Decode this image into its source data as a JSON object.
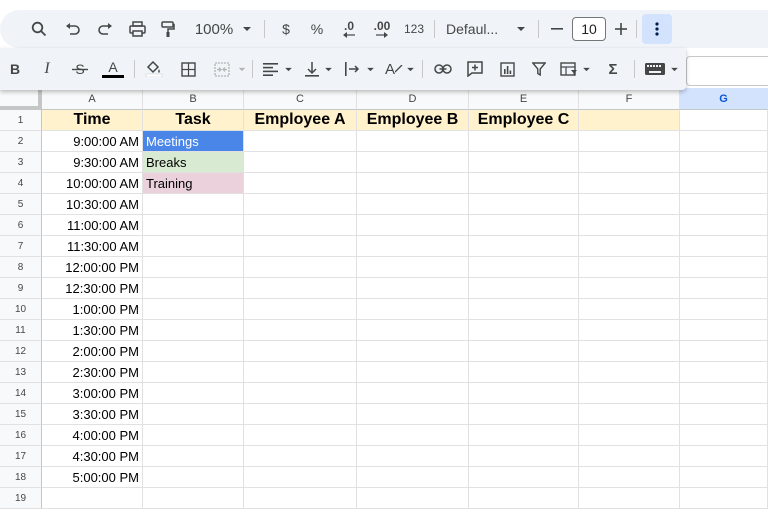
{
  "toolbar": {
    "zoom": "100%",
    "currency": "$",
    "percent": "%",
    "decrease_decimal": ".0",
    "increase_decimal": ".00",
    "number_format": "123",
    "font": "Defaul...",
    "font_size": "10",
    "bold": "B",
    "italic": "I",
    "text_color_label": "A",
    "text_rotation_label": "A",
    "sum": "Σ"
  },
  "colors": {
    "toolbar_bg": "#f0f4f9",
    "header_fill": "#fff2cc",
    "meetings_fill": "#4a86e8",
    "breaks_fill": "#d9ead3",
    "training_fill": "#ead1dc",
    "selected_col": "#d3e3fd"
  },
  "sheet": {
    "columns": [
      "A",
      "B",
      "C",
      "D",
      "E",
      "F",
      "G"
    ],
    "selected_column": "G",
    "rows": [
      "1",
      "2",
      "3",
      "4",
      "5",
      "6",
      "7",
      "8",
      "9",
      "10",
      "11",
      "12",
      "13",
      "14",
      "15",
      "16",
      "17",
      "18",
      "19"
    ],
    "headers": [
      "Time",
      "Task",
      "Employee A",
      "Employee B",
      "Employee C"
    ],
    "times": [
      "9:00:00 AM",
      "9:30:00 AM",
      "10:00:00 AM",
      "10:30:00 AM",
      "11:00:00 AM",
      "11:30:00 AM",
      "12:00:00 PM",
      "12:30:00 PM",
      "1:00:00 PM",
      "1:30:00 PM",
      "2:00:00 PM",
      "2:30:00 PM",
      "3:00:00 PM",
      "3:30:00 PM",
      "4:00:00 PM",
      "4:30:00 PM",
      "5:00:00 PM"
    ],
    "tasks": [
      "Meetings",
      "Breaks",
      "Training"
    ]
  }
}
